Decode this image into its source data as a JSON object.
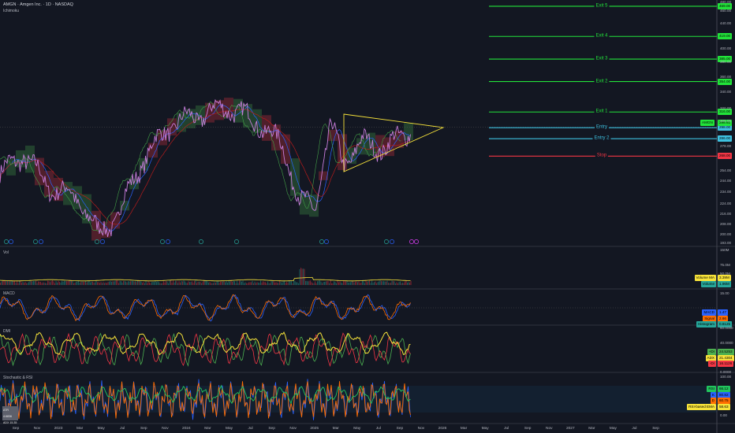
{
  "header": {
    "symbol_line": "AMGN · Amgen Inc. · 1D · NASDAQ",
    "indicator": "Ichimoku"
  },
  "levels": [
    {
      "label": "Exit 5",
      "price": "469.00",
      "color": "#22e33a"
    },
    {
      "label": "Exit 4",
      "price": "419.00",
      "color": "#22e33a"
    },
    {
      "label": "Exit 3",
      "price": "385.00",
      "color": "#22e33a"
    },
    {
      "label": "Exit 2",
      "price": "354.00",
      "color": "#22e33a"
    },
    {
      "label": "Exit 1",
      "price": "316.00",
      "color": "#22e33a"
    },
    {
      "label": "Entry",
      "price": "298.00",
      "color": "#3ec1e0"
    },
    {
      "label": "Entry 2",
      "price": "286.00",
      "color": "#3ec1e0"
    },
    {
      "label": "Stop",
      "price": "268.00",
      "color": "#f23645"
    }
  ],
  "last_price": {
    "symbol": "AMGN",
    "price": "298.61"
  },
  "price_axis": [
    "480.00",
    "460.00",
    "440.00",
    "400.00",
    "380.00",
    "360.00",
    "340.00",
    "320.00",
    "305.00",
    "278.00",
    "254.00",
    "244.00",
    "234.00",
    "224.00",
    "216.00",
    "208.00",
    "200.00",
    "193.00"
  ],
  "panes": {
    "vol": {
      "title": "Vol",
      "axis": [
        "150M",
        "75.0M",
        "50.0M"
      ],
      "legend": [
        {
          "label": "Volume MA",
          "value": "3.39M",
          "color": "#f7e33a"
        },
        {
          "label": "Volume",
          "value": "1.96M",
          "color": "#26a69a"
        }
      ]
    },
    "macd": {
      "title": "MACD",
      "axis": [
        "15.00",
        "-10.00"
      ],
      "legend": [
        {
          "label": "MACD",
          "value": "1.47",
          "color": "#2962ff"
        },
        {
          "label": "Signal",
          "value": "2.66",
          "color": "#ff6d00"
        },
        {
          "label": "Histogram",
          "value": "0.8125",
          "color": "#26a69a"
        }
      ]
    },
    "dmi": {
      "title": "DMI",
      "axis": [
        "60.0000",
        "40.0000",
        "0.0000"
      ],
      "legend": [
        {
          "label": "+DI",
          "value": "24.5253",
          "color": "#4caf50"
        },
        {
          "label": "ADX",
          "value": "21.4304",
          "color": "#f7e33a"
        },
        {
          "label": "-DI",
          "value": "16.1126",
          "color": "#f23645"
        }
      ]
    },
    "stoch": {
      "title": "Stochastic & RSI",
      "axis": [
        "100.00",
        "75.00",
        "50.00",
        "25.00",
        "0.00"
      ],
      "legend": [
        {
          "label": "RSI",
          "value": "66.12",
          "color": "#22c55e"
        },
        {
          "label": "K",
          "value": "80.82",
          "color": "#2962ff"
        },
        {
          "label": "D",
          "value": "60.75",
          "color": "#ff6d00"
        },
        {
          "label": "RSI-based EMA",
          "value": "58.63",
          "color": "#f7e33a"
        }
      ],
      "box": [
        "ATR 4.6836",
        "ADX 15.35"
      ]
    }
  },
  "time_axis": [
    "Sep",
    "Nov",
    "2023",
    "Mar",
    "May",
    "Jul",
    "Sep",
    "Nov",
    "2024",
    "Mar",
    "May",
    "Jul",
    "Sep",
    "Nov",
    "2025",
    "Mar",
    "May",
    "Jul",
    "Sep",
    "Nov",
    "2026",
    "Mar",
    "May",
    "Jul",
    "Sep",
    "Nov",
    "2027",
    "Mar",
    "May",
    "Jul",
    "Sep"
  ]
}
